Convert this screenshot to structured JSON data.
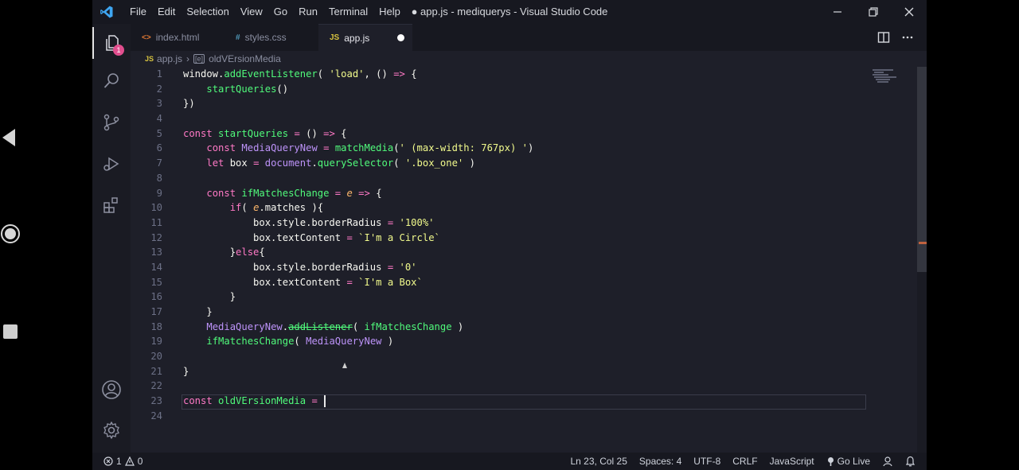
{
  "window_title": "● app.js - mediquerys - Visual Studio Code",
  "menu": [
    "File",
    "Edit",
    "Selection",
    "View",
    "Go",
    "Run",
    "Terminal",
    "Help"
  ],
  "activity_badge": "1",
  "tabs": [
    {
      "label": "index.html",
      "icon": "<>",
      "icon_color": "#e37933"
    },
    {
      "label": "styles.css",
      "icon": "#",
      "icon_color": "#519aba"
    },
    {
      "label": "app.js",
      "icon": "JS",
      "icon_color": "#d6c23f",
      "active": true,
      "dirty": true
    }
  ],
  "breadcrumb": {
    "file": "app.js",
    "file_icon": "JS",
    "symbol": "oldVErsionMedia",
    "symbol_icon": "[e]"
  },
  "line_numbers": [
    "1",
    "2",
    "3",
    "4",
    "5",
    "6",
    "7",
    "8",
    "9",
    "10",
    "11",
    "12",
    "13",
    "14",
    "15",
    "16",
    "17",
    "18",
    "19",
    "20",
    "21",
    "22",
    "23",
    "24"
  ],
  "code_lines": [
    "window.addEventListener( 'load', () => {",
    "    startQueries()",
    "})",
    "",
    "const startQueries = () => {",
    "    const MediaQueryNew = matchMedia(' (max-width: 767px) ')",
    "    let box = document.querySelector( '.box_one' )",
    "",
    "    const ifMatchesChange = e => {",
    "        if( e.matches ){",
    "            box.style.borderRadius = '100%'",
    "            box.textContent = `I'm a Circle`",
    "        }else{",
    "            box.style.borderRadius = '0'",
    "            box.textContent = `I'm a Box`",
    "        }",
    "    }",
    "    MediaQueryNew.addListener( ifMatchesChange )",
    "    ifMatchesChange( MediaQueryNew )",
    "",
    "}",
    "",
    "const oldVErsionMedia = ",
    ""
  ],
  "status": {
    "errors": "1",
    "warnings": "0",
    "position": "Ln 23, Col 25",
    "spaces": "Spaces: 4",
    "encoding": "UTF-8",
    "eol": "CRLF",
    "language": "JavaScript",
    "golive": "Go Live"
  },
  "colors": {
    "keyword": "#ff79c6",
    "function": "#50fa7b",
    "string": "#f1fa8c",
    "variable": "#bd93f9",
    "param": "#ffb86c",
    "badge": "#e14e8e"
  }
}
